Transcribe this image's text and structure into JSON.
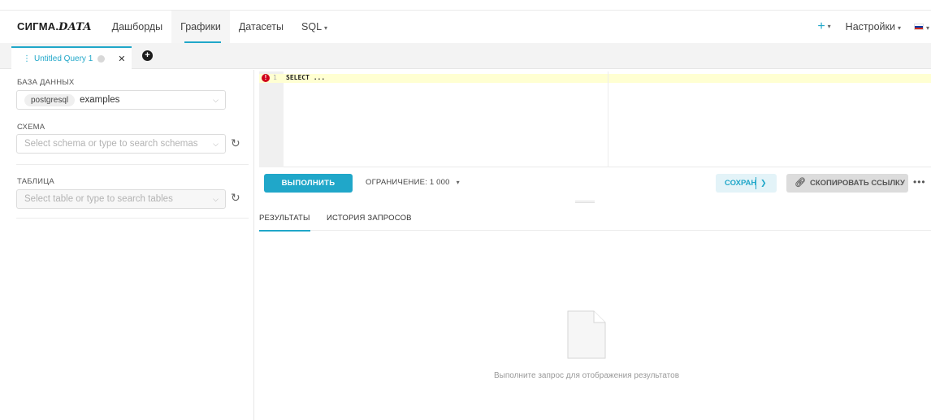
{
  "navbar": {
    "brand_a": "СИГМА.",
    "brand_b": "DATA",
    "items": [
      {
        "label": "Дашборды",
        "has_caret": false
      },
      {
        "label": "Графики",
        "has_caret": false
      },
      {
        "label": "Датасеты",
        "has_caret": false
      },
      {
        "label": "SQL",
        "has_caret": true
      }
    ],
    "active_item": "Графики",
    "plus_label": "+",
    "settings_label": "Настройки"
  },
  "tabs": {
    "query_tab_title": "Untitled Query 1",
    "close_glyph": "✕",
    "add_glyph": "+"
  },
  "left_panel": {
    "database_label": "БАЗА ДАННЫХ",
    "database_engine": "postgresql",
    "database_name": "examples",
    "schema_label": "СХЕМА",
    "schema_placeholder": "Select schema or type to search schemas",
    "table_label": "ТАБЛИЦА",
    "table_placeholder": "Select table or type to search tables"
  },
  "editor": {
    "line_number": "1",
    "code": "SELECT ...",
    "error_glyph": "!"
  },
  "toolbar": {
    "run_label": "ВЫПОЛНИТЬ",
    "limit_label": "ОГРАНИЧЕНИЕ: 1 000",
    "save_label": "СОХРАН",
    "copy_link_label": "СКОПИРОВАТЬ ССЫЛКУ",
    "more_glyph": "•••"
  },
  "results": {
    "tabs": [
      "РЕЗУЛЬТАТЫ",
      "ИСТОРИЯ ЗАПРОСОВ"
    ],
    "empty_message": "Выполните запрос для отображения результатов"
  },
  "colors": {
    "accent": "#20a7c9",
    "error": "#d0021b"
  }
}
